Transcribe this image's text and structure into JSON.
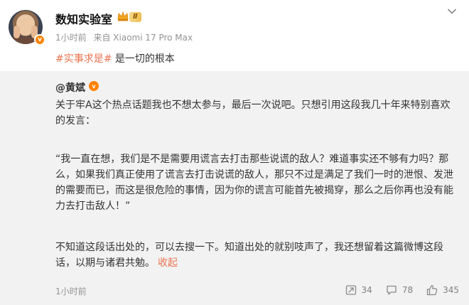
{
  "post": {
    "username": "数知实验室",
    "level_badge": "Ⅱ",
    "time": "1小时前",
    "source": "来自 Xiaomi 17 Pro Max",
    "hashtag": "#实事求是#",
    "text": " 是一切的根本"
  },
  "repost": {
    "author": "@黄斌",
    "paragraph1": "关于牢A这个热点话题我也不想太参与，最后一次说吧。只想引用这段我几十年来特别喜欢的发言：",
    "paragraph2": "“我一直在想，我们是不是需要用谎言去打击那些说谎的敌人？难道事实还不够有力吗？那么，如果我们真正使用了谎言去打击说谎的敌人，那只不过是满足了我们一时的泄恨、发泄的需要而已，而这是很危险的事情，因为你的谎言可能首先被揭穿，那么之后你再也没有能力去打击敌人！”",
    "paragraph3": "不知道这段话出处的，可以去搜一下。知道出处的就别吱声了，我还想留着这篇微博这段话，以期与诸君共勉。",
    "collapse_label": "收起",
    "time": "1小时前",
    "repost_count": "34",
    "comment_count": "78",
    "like_count": "345"
  },
  "colors": {
    "accent": "#eb7350",
    "verified": "#ff8200",
    "repost_bg": "#f2f2f2"
  },
  "icons": [
    "verified-icon",
    "crown-icon",
    "chevron-down-icon",
    "repost-icon",
    "comment-icon",
    "like-icon"
  ]
}
